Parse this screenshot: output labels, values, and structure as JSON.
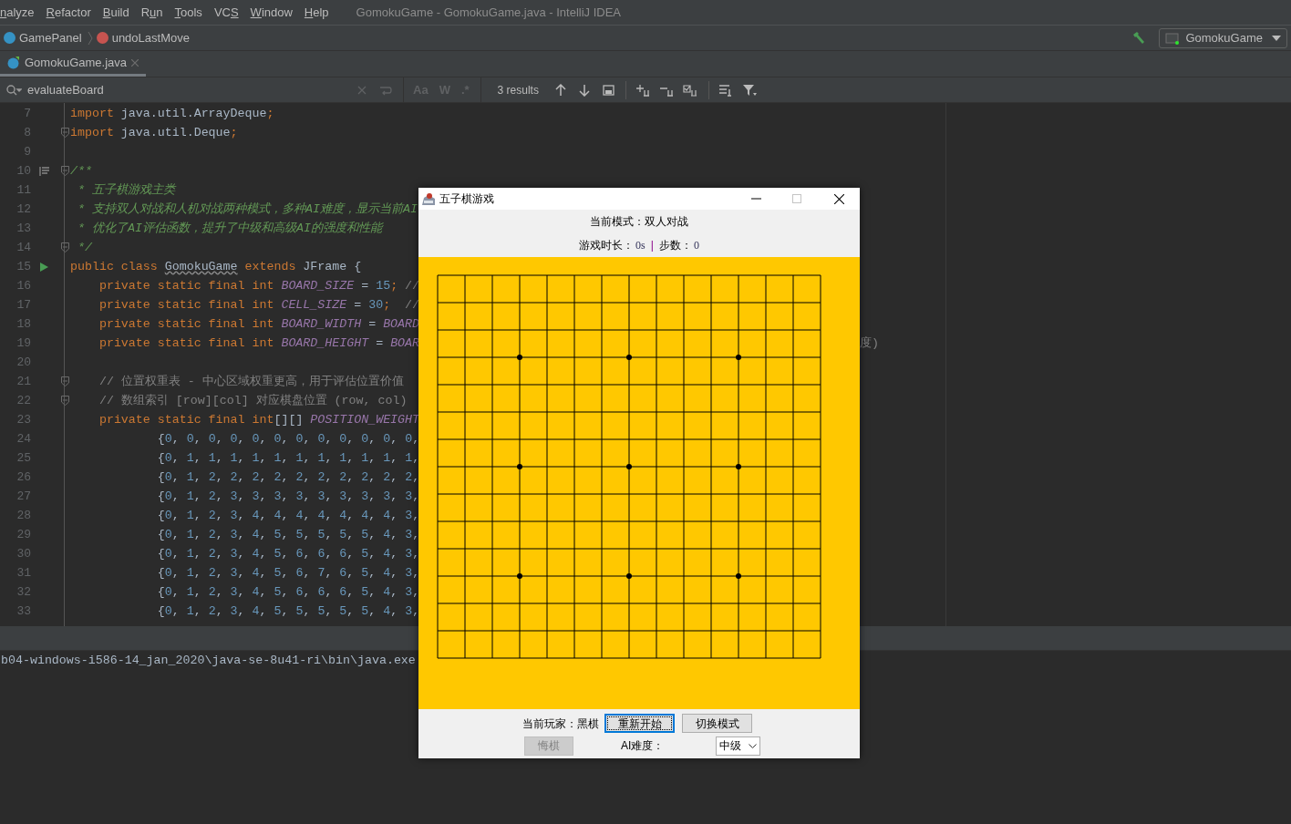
{
  "menu": [
    {
      "label": "nalyze"
    },
    {
      "label": "Refactor"
    },
    {
      "label": "Build"
    },
    {
      "label": "Run"
    },
    {
      "label": "Tools"
    },
    {
      "label": "VCS"
    },
    {
      "label": "Window"
    },
    {
      "label": "Help"
    }
  ],
  "window": {
    "title": "GomokuGame - GomokuGame.java - IntelliJ IDEA"
  },
  "breadcrumbs": [
    {
      "kind": "class",
      "label": "GamePanel"
    },
    {
      "kind": "method",
      "label": "undoLastMove"
    }
  ],
  "run_config": "GomokuGame",
  "tabs": [
    {
      "label": "GomokuGame.java",
      "selected": true
    }
  ],
  "search": {
    "value": "evaluateBoard",
    "toggles": [
      "Aa",
      "W",
      ".*"
    ],
    "result_count": "3 results"
  },
  "editor": {
    "lines": [
      {
        "number": "7",
        "tokens": [
          {
            "kind": "keyword",
            "text": "import "
          },
          {
            "kind": "plain",
            "text": "java.util.ArrayDeque"
          },
          {
            "kind": "keyword",
            "text": ";"
          }
        ]
      },
      {
        "number": "8",
        "fold": true,
        "tokens": [
          {
            "kind": "keyword",
            "text": "import "
          },
          {
            "kind": "plain",
            "text": "java.util.Deque"
          },
          {
            "kind": "keyword",
            "text": ";"
          }
        ]
      },
      {
        "number": "9"
      },
      {
        "number": "10",
        "doc_icon": true,
        "fold": true,
        "tokens": [
          {
            "kind": "doc",
            "text": "/**"
          }
        ]
      },
      {
        "number": "11",
        "tokens": [
          {
            "kind": "doc",
            "text": " * 五子棋游戏主类"
          }
        ]
      },
      {
        "number": "12",
        "tokens": [
          {
            "kind": "doc",
            "text": " * 支持双人对战和人机对战两种模式，多种AI难度，显示当前AI"
          }
        ]
      },
      {
        "number": "13",
        "tokens": [
          {
            "kind": "doc",
            "text": " * 优化了AI评估函数，提升了中级和高级AI的强度和性能"
          }
        ]
      },
      {
        "number": "14",
        "fold": true,
        "tokens": [
          {
            "kind": "doc",
            "text": " */"
          }
        ]
      },
      {
        "number": "15",
        "run": true,
        "tokens": [
          {
            "kind": "keyword",
            "text": "public class "
          },
          {
            "kind": "misspelled",
            "text": "GomokuGame"
          },
          {
            "kind": "keyword",
            "text": " extends "
          },
          {
            "kind": "plain",
            "text": "JFrame {"
          }
        ]
      },
      {
        "number": "16",
        "tokens": [
          {
            "kind": "keyword",
            "text": "    private static final int "
          },
          {
            "kind": "constant",
            "text": "BOARD_SIZE"
          },
          {
            "kind": "plain",
            "text": " = "
          },
          {
            "kind": "number",
            "text": "15"
          },
          {
            "kind": "keyword",
            "text": ";"
          },
          {
            "kind": "comment",
            "text": " //"
          }
        ]
      },
      {
        "number": "17",
        "tokens": [
          {
            "kind": "keyword",
            "text": "    private static final int "
          },
          {
            "kind": "constant",
            "text": "CELL_SIZE"
          },
          {
            "kind": "plain",
            "text": " = "
          },
          {
            "kind": "number",
            "text": "30"
          },
          {
            "kind": "keyword",
            "text": ";"
          },
          {
            "kind": "comment",
            "text": "  //"
          }
        ]
      },
      {
        "number": "18",
        "tokens": [
          {
            "kind": "keyword",
            "text": "    private static final int "
          },
          {
            "kind": "constant",
            "text": "BOARD_WIDTH"
          },
          {
            "kind": "plain",
            "text": " = "
          },
          {
            "kind": "constant",
            "text": "BOARD"
          }
        ]
      },
      {
        "number": "19",
        "tokens": [
          {
            "kind": "keyword",
            "text": "    private static final int "
          },
          {
            "kind": "constant",
            "text": "BOARD_HEIGHT"
          },
          {
            "kind": "plain",
            "text": " = "
          },
          {
            "kind": "constant",
            "text": "BOAR"
          }
        ],
        "tail": "度)"
      },
      {
        "number": "20"
      },
      {
        "number": "21",
        "fold": true,
        "tokens": [
          {
            "kind": "comment",
            "text": "    // 位置权重表 - 中心区域权重更高，用于评估位置价值"
          }
        ]
      },
      {
        "number": "22",
        "fold": true,
        "tokens": [
          {
            "kind": "comment",
            "text": "    // 数组索引 [row][col] 对应棋盘位置 (row, col)"
          }
        ]
      },
      {
        "number": "23",
        "tokens": [
          {
            "kind": "keyword",
            "text": "    private static final int"
          },
          {
            "kind": "plain",
            "text": "[][] "
          },
          {
            "kind": "constant",
            "text": "POSITION_WEIGHT"
          }
        ]
      },
      {
        "number": "24",
        "tokens": [
          {
            "kind": "array",
            "text": "            {0, 0, 0, 0, 0, 0, 0, 0, 0, 0, 0, 0,"
          }
        ]
      },
      {
        "number": "25",
        "tokens": [
          {
            "kind": "array",
            "text": "            {0, 1, 1, 1, 1, 1, 1, 1, 1, 1, 1, 1,"
          }
        ]
      },
      {
        "number": "26",
        "tokens": [
          {
            "kind": "array",
            "text": "            {0, 1, 2, 2, 2, 2, 2, 2, 2, 2, 2, 2,"
          }
        ]
      },
      {
        "number": "27",
        "tokens": [
          {
            "kind": "array",
            "text": "            {0, 1, 2, 3, 3, 3, 3, 3, 3, 3, 3, 3,"
          }
        ]
      },
      {
        "number": "28",
        "tokens": [
          {
            "kind": "array",
            "text": "            {0, 1, 2, 3, 4, 4, 4, 4, 4, 4, 4, 3,"
          }
        ]
      },
      {
        "number": "29",
        "tokens": [
          {
            "kind": "array",
            "text": "            {0, 1, 2, 3, 4, 5, 5, 5, 5, 5, 4, 3,"
          }
        ]
      },
      {
        "number": "30",
        "tokens": [
          {
            "kind": "array",
            "text": "            {0, 1, 2, 3, 4, 5, 6, 6, 6, 5, 4, 3,"
          }
        ]
      },
      {
        "number": "31",
        "tokens": [
          {
            "kind": "array",
            "text": "            {0, 1, 2, 3, 4, 5, 6, 7, 6, 5, 4, 3,"
          }
        ]
      },
      {
        "number": "32",
        "tokens": [
          {
            "kind": "array",
            "text": "            {0, 1, 2, 3, 4, 5, 6, 6, 6, 5, 4, 3,"
          }
        ]
      },
      {
        "number": "33",
        "tokens": [
          {
            "kind": "array",
            "text": "            {0, 1, 2, 3, 4, 5, 5, 5, 5, 5, 4, 3,"
          }
        ]
      }
    ]
  },
  "console": {
    "text": "b04-windows-i586-14_jan_2020\\java-se-8u41-ri\\bin\\java.exe"
  },
  "game_window": {
    "title": "五子棋游戏",
    "mode": "当前模式：双人对战",
    "stats": [
      {
        "label": "游戏时长：",
        "value": "0s"
      },
      {
        "label": "步数：",
        "value": "0"
      }
    ],
    "separator": "|",
    "current_player": "当前玩家：黑棋",
    "buttons": [
      {
        "label": "重新开始",
        "focused": true,
        "disabled": false
      },
      {
        "label": "切换模式",
        "focused": false,
        "disabled": false
      }
    ],
    "undo_button": {
      "label": "悔棋",
      "disabled": true
    },
    "ai_label": "AI难度：",
    "difficulty": "中级"
  }
}
